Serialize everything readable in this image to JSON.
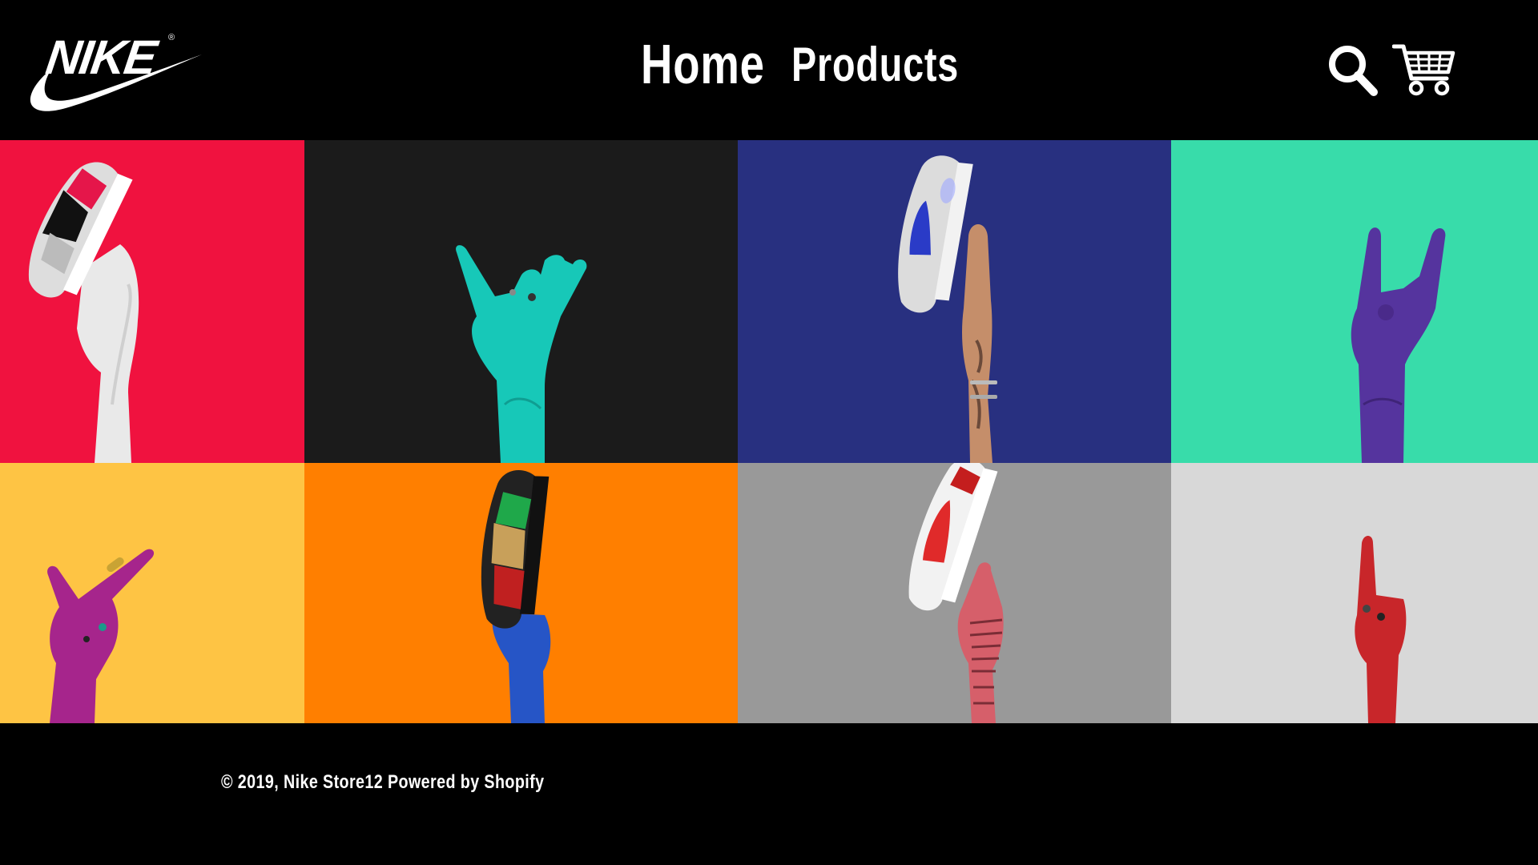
{
  "header": {
    "brand": "NIKE",
    "brand_mark": "®",
    "nav": {
      "home": "Home",
      "products": "Products"
    },
    "icons": {
      "search": "search-icon",
      "cart": "cart-icon"
    }
  },
  "tiles": [
    {
      "id": "tile-1",
      "background": "#F0123F",
      "subject": "white-hand-holding-red-grey-sneaker"
    },
    {
      "id": "tile-2",
      "background": "#1B1B1B",
      "subject": "teal-hand-shaka-sign"
    },
    {
      "id": "tile-3",
      "background": "#283080",
      "subject": "tattooed-hand-holding-blue-sneaker"
    },
    {
      "id": "tile-4",
      "background": "#38DCAA",
      "subject": "purple-hand-rock-sign"
    },
    {
      "id": "tile-5",
      "background": "#FEC444",
      "subject": "magenta-hand-pointing"
    },
    {
      "id": "tile-6",
      "background": "#FF7F00",
      "subject": "blue-hand-holding-patterned-sneaker"
    },
    {
      "id": "tile-7",
      "background": "#999999",
      "subject": "striped-hand-holding-red-sneaker"
    },
    {
      "id": "tile-8",
      "background": "#D8D8D8",
      "subject": "red-hand-index-finger-up"
    }
  ],
  "footer": {
    "copyright": "© 2019, Nike Store12 Powered by Shopify"
  },
  "colors": {
    "header_bg": "#000000",
    "footer_bg": "#000000",
    "text": "#FFFFFF"
  }
}
